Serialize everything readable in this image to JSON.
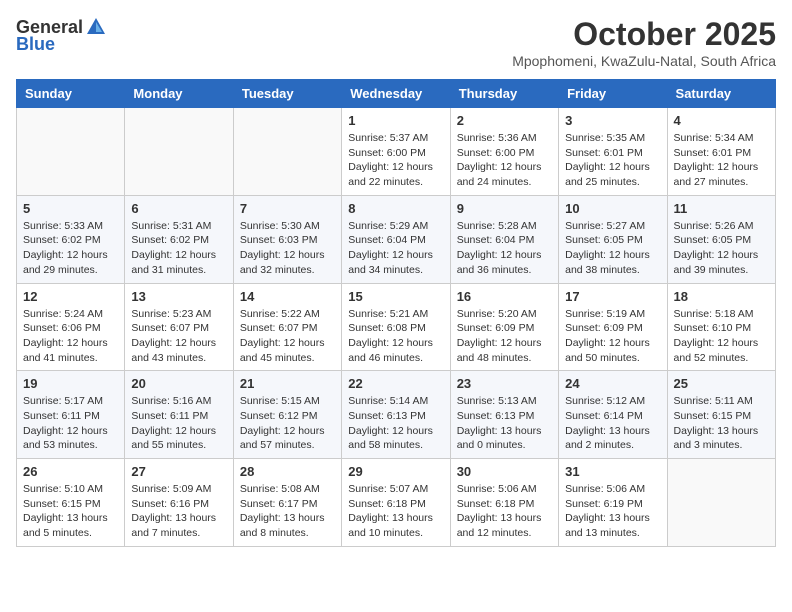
{
  "header": {
    "logo_general": "General",
    "logo_blue": "Blue",
    "month_title": "October 2025",
    "location": "Mpophomeni, KwaZulu-Natal, South Africa"
  },
  "days_of_week": [
    "Sunday",
    "Monday",
    "Tuesday",
    "Wednesday",
    "Thursday",
    "Friday",
    "Saturday"
  ],
  "weeks": [
    [
      {
        "day": "",
        "info": ""
      },
      {
        "day": "",
        "info": ""
      },
      {
        "day": "",
        "info": ""
      },
      {
        "day": "1",
        "info": "Sunrise: 5:37 AM\nSunset: 6:00 PM\nDaylight: 12 hours\nand 22 minutes."
      },
      {
        "day": "2",
        "info": "Sunrise: 5:36 AM\nSunset: 6:00 PM\nDaylight: 12 hours\nand 24 minutes."
      },
      {
        "day": "3",
        "info": "Sunrise: 5:35 AM\nSunset: 6:01 PM\nDaylight: 12 hours\nand 25 minutes."
      },
      {
        "day": "4",
        "info": "Sunrise: 5:34 AM\nSunset: 6:01 PM\nDaylight: 12 hours\nand 27 minutes."
      }
    ],
    [
      {
        "day": "5",
        "info": "Sunrise: 5:33 AM\nSunset: 6:02 PM\nDaylight: 12 hours\nand 29 minutes."
      },
      {
        "day": "6",
        "info": "Sunrise: 5:31 AM\nSunset: 6:02 PM\nDaylight: 12 hours\nand 31 minutes."
      },
      {
        "day": "7",
        "info": "Sunrise: 5:30 AM\nSunset: 6:03 PM\nDaylight: 12 hours\nand 32 minutes."
      },
      {
        "day": "8",
        "info": "Sunrise: 5:29 AM\nSunset: 6:04 PM\nDaylight: 12 hours\nand 34 minutes."
      },
      {
        "day": "9",
        "info": "Sunrise: 5:28 AM\nSunset: 6:04 PM\nDaylight: 12 hours\nand 36 minutes."
      },
      {
        "day": "10",
        "info": "Sunrise: 5:27 AM\nSunset: 6:05 PM\nDaylight: 12 hours\nand 38 minutes."
      },
      {
        "day": "11",
        "info": "Sunrise: 5:26 AM\nSunset: 6:05 PM\nDaylight: 12 hours\nand 39 minutes."
      }
    ],
    [
      {
        "day": "12",
        "info": "Sunrise: 5:24 AM\nSunset: 6:06 PM\nDaylight: 12 hours\nand 41 minutes."
      },
      {
        "day": "13",
        "info": "Sunrise: 5:23 AM\nSunset: 6:07 PM\nDaylight: 12 hours\nand 43 minutes."
      },
      {
        "day": "14",
        "info": "Sunrise: 5:22 AM\nSunset: 6:07 PM\nDaylight: 12 hours\nand 45 minutes."
      },
      {
        "day": "15",
        "info": "Sunrise: 5:21 AM\nSunset: 6:08 PM\nDaylight: 12 hours\nand 46 minutes."
      },
      {
        "day": "16",
        "info": "Sunrise: 5:20 AM\nSunset: 6:09 PM\nDaylight: 12 hours\nand 48 minutes."
      },
      {
        "day": "17",
        "info": "Sunrise: 5:19 AM\nSunset: 6:09 PM\nDaylight: 12 hours\nand 50 minutes."
      },
      {
        "day": "18",
        "info": "Sunrise: 5:18 AM\nSunset: 6:10 PM\nDaylight: 12 hours\nand 52 minutes."
      }
    ],
    [
      {
        "day": "19",
        "info": "Sunrise: 5:17 AM\nSunset: 6:11 PM\nDaylight: 12 hours\nand 53 minutes."
      },
      {
        "day": "20",
        "info": "Sunrise: 5:16 AM\nSunset: 6:11 PM\nDaylight: 12 hours\nand 55 minutes."
      },
      {
        "day": "21",
        "info": "Sunrise: 5:15 AM\nSunset: 6:12 PM\nDaylight: 12 hours\nand 57 minutes."
      },
      {
        "day": "22",
        "info": "Sunrise: 5:14 AM\nSunset: 6:13 PM\nDaylight: 12 hours\nand 58 minutes."
      },
      {
        "day": "23",
        "info": "Sunrise: 5:13 AM\nSunset: 6:13 PM\nDaylight: 13 hours\nand 0 minutes."
      },
      {
        "day": "24",
        "info": "Sunrise: 5:12 AM\nSunset: 6:14 PM\nDaylight: 13 hours\nand 2 minutes."
      },
      {
        "day": "25",
        "info": "Sunrise: 5:11 AM\nSunset: 6:15 PM\nDaylight: 13 hours\nand 3 minutes."
      }
    ],
    [
      {
        "day": "26",
        "info": "Sunrise: 5:10 AM\nSunset: 6:15 PM\nDaylight: 13 hours\nand 5 minutes."
      },
      {
        "day": "27",
        "info": "Sunrise: 5:09 AM\nSunset: 6:16 PM\nDaylight: 13 hours\nand 7 minutes."
      },
      {
        "day": "28",
        "info": "Sunrise: 5:08 AM\nSunset: 6:17 PM\nDaylight: 13 hours\nand 8 minutes."
      },
      {
        "day": "29",
        "info": "Sunrise: 5:07 AM\nSunset: 6:18 PM\nDaylight: 13 hours\nand 10 minutes."
      },
      {
        "day": "30",
        "info": "Sunrise: 5:06 AM\nSunset: 6:18 PM\nDaylight: 13 hours\nand 12 minutes."
      },
      {
        "day": "31",
        "info": "Sunrise: 5:06 AM\nSunset: 6:19 PM\nDaylight: 13 hours\nand 13 minutes."
      },
      {
        "day": "",
        "info": ""
      }
    ]
  ]
}
